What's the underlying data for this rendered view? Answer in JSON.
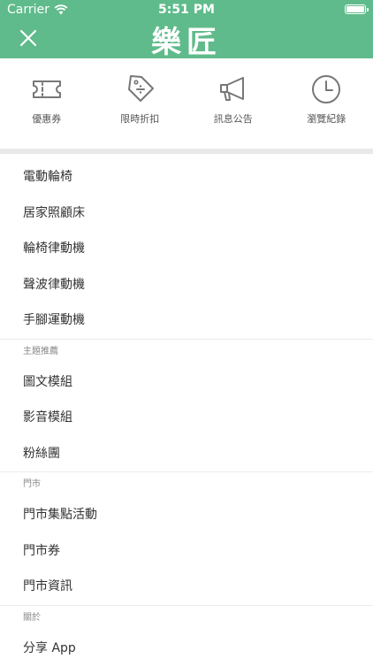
{
  "status_bar": {
    "carrier": "Carrier",
    "time": "5:51 PM"
  },
  "header": {
    "logo_text": "樂匠",
    "bg_color": "#5fbb8b"
  },
  "quick_links": [
    {
      "label": "優惠券",
      "icon": "ticket-icon"
    },
    {
      "label": "限時折扣",
      "icon": "discount-tag-icon"
    },
    {
      "label": "訊息公告",
      "icon": "megaphone-icon"
    },
    {
      "label": "瀏覽紀錄",
      "icon": "clock-icon"
    }
  ],
  "categories": [
    "電動輪椅",
    "居家照顧床",
    "輪椅律動機",
    "聲波律動機",
    "手腳運動機"
  ],
  "sections": [
    {
      "title": "主題推薦",
      "items": [
        "圖文模組",
        "影音模組",
        "粉絲團"
      ]
    },
    {
      "title": "門市",
      "items": [
        "門市集點活動",
        "門市券",
        "門市資訊"
      ]
    },
    {
      "title": "關於",
      "items": [
        "分享 App"
      ]
    }
  ]
}
